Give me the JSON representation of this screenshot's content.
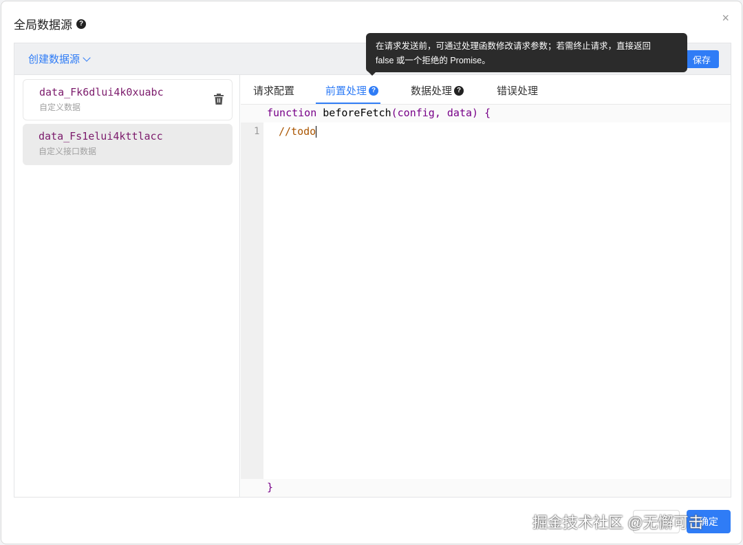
{
  "dialog": {
    "title": "全局数据源",
    "help_icon": "question-icon",
    "close_icon": "close-icon",
    "close_label": "×"
  },
  "toolbar": {
    "create_label": "创建数据源",
    "save_label": "保存"
  },
  "datasources": [
    {
      "name": "data_Fk6dlui4k0xuabc",
      "type": "自定义数据"
    },
    {
      "name": "data_Fs1elui4kttlacc",
      "type": "自定义接口数据"
    }
  ],
  "tabs": [
    {
      "label": "请求配置"
    },
    {
      "label": "前置处理",
      "help": "?"
    },
    {
      "label": "数据处理",
      "help": "?"
    },
    {
      "label": "错误处理"
    }
  ],
  "editor": {
    "line1_keyword": "function",
    "line1_fn": "beforeFetch",
    "line1_rest": "(config, data) {",
    "line_number": "1",
    "line2": "//todo",
    "line_end": "}"
  },
  "tooltip": {
    "line1": "在请求发送前，可通过处理函数修改请求参数；若需终止请求，直接返回",
    "line2": "false 或一个拒绝的 Promise。"
  },
  "footer": {
    "confirm_label": "确定"
  },
  "watermark": "掘金技术社区 @无懈可击",
  "colors": {
    "accent": "#2f7cf6",
    "keyword": "#770088",
    "comment": "#aa5500"
  }
}
